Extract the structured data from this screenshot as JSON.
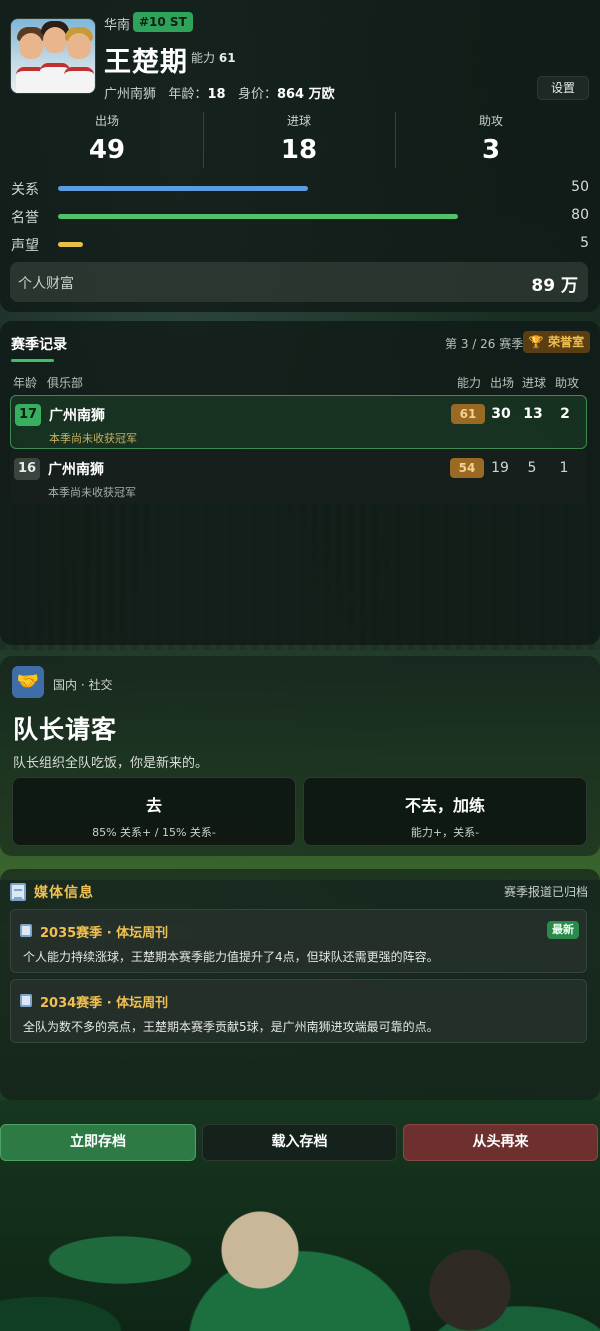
{
  "player": {
    "region": "华南",
    "number_badge": "#10 ST",
    "name": "王楚期",
    "ability_label": "能力",
    "ability_value": "61",
    "club": "广州南狮",
    "age_label": "年龄：",
    "age_value": "18",
    "value_label": "身价：",
    "value_value": "864 万欧",
    "settings_label": "设置"
  },
  "stats": [
    {
      "label": "出场",
      "value": "49"
    },
    {
      "label": "进球",
      "value": "18"
    },
    {
      "label": "助攻",
      "value": "3"
    }
  ],
  "bars": [
    {
      "label": "关系",
      "value": 50,
      "max": 100,
      "display": "50",
      "color": "#5b9be0"
    },
    {
      "label": "名誉",
      "value": 80,
      "max": 100,
      "display": "80",
      "color": "#55c06a"
    },
    {
      "label": "声望",
      "value": 5,
      "max": 100,
      "display": "5",
      "color": "#e8c048"
    }
  ],
  "wealth": {
    "label": "个人财富",
    "value": "89 万"
  },
  "season": {
    "title": "赛季记录",
    "count": "第 3 / 26 赛季",
    "honor_label": "荣誉室",
    "columns": {
      "age": "年龄",
      "club": "俱乐部",
      "ability": "能力",
      "apps": "出场",
      "goals": "进球",
      "assists": "助攻"
    },
    "records": [
      {
        "age": "17",
        "club": "广州南狮",
        "note": "本季尚未收获冠军",
        "ability": "61",
        "apps": "30",
        "goals": "13",
        "assists": "2"
      },
      {
        "age": "16",
        "club": "广州南狮",
        "note": "本季尚未收获冠军",
        "ability": "54",
        "apps": "19",
        "goals": "5",
        "assists": "1"
      }
    ]
  },
  "event": {
    "icon": "handshake-icon",
    "tag": "国内 · 社交",
    "title": "队长请客",
    "description": "队长组织全队吃饭，你是新来的。",
    "choices": [
      {
        "title": "去",
        "subtitle": "85% 关系+ / 15% 关系-"
      },
      {
        "title": "不去，加练",
        "subtitle": "能力+，关系-"
      }
    ]
  },
  "media": {
    "title": "媒体信息",
    "archived": "赛季报道已归档",
    "news": [
      {
        "headline": "2035赛季 · 体坛周刊",
        "badge": "最新",
        "body": "个人能力持续涨球，王楚期本赛季能力值提升了4点，但球队还需更强的阵容。"
      },
      {
        "headline": "2034赛季 · 体坛周刊",
        "badge": "",
        "body": "全队为数不多的亮点，王楚期本赛季贡献5球，是广州南狮进攻端最可靠的点。"
      }
    ]
  },
  "actions": {
    "save": "立即存档",
    "load": "载入存档",
    "restart": "从头再来"
  }
}
